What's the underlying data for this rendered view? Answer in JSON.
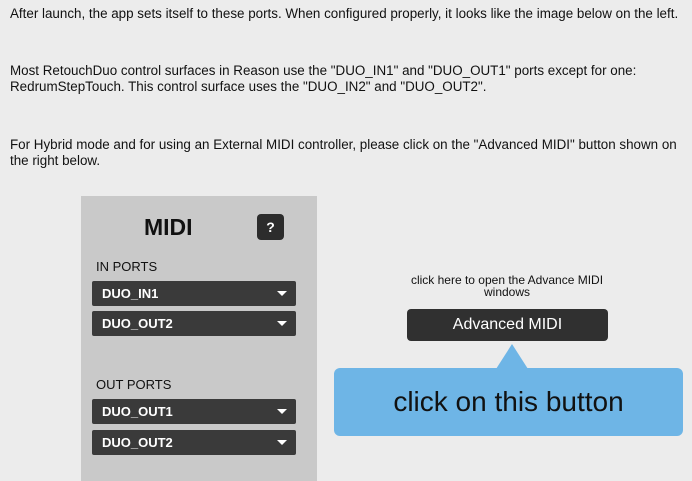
{
  "instructions": {
    "p1": "After launch, the app sets itself to these ports. When configured properly, it looks like the image below on the left.",
    "p2": "Most RetouchDuo control surfaces in Reason use the \"DUO_IN1\" and \"DUO_OUT1\" ports except for one: RedrumStepTouch. This control surface uses the \"DUO_IN2\" and \"DUO_OUT2\".",
    "p3": "For Hybrid mode and for using an External MIDI controller, please click on the  \"Advanced MIDI\" button shown on the right below."
  },
  "midi_panel": {
    "title": "MIDI",
    "help_label": "?",
    "in_ports_label": "IN PORTS",
    "in_ports": [
      "DUO_IN1",
      "DUO_OUT2"
    ],
    "out_ports_label": "OUT PORTS",
    "out_ports": [
      "DUO_OUT1",
      "DUO_OUT2"
    ]
  },
  "advanced": {
    "hint": "click here to open the Advance MIDI windows",
    "button_label": "Advanced MIDI"
  },
  "callout": {
    "text": "click on this button",
    "color": "#6eb5e6"
  }
}
